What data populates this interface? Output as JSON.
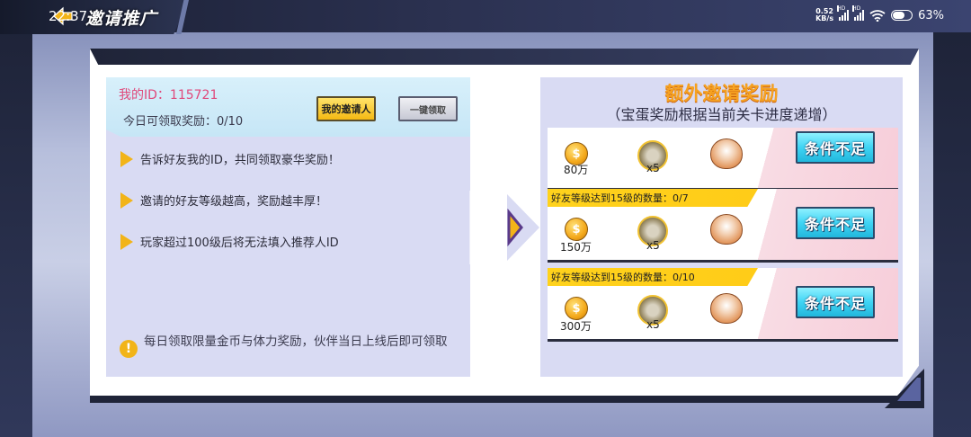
{
  "statusbar": {
    "time": "22:37",
    "speed_top": "0.52",
    "speed_bottom": "KB/s",
    "battery": "63%"
  },
  "header": {
    "title": "邀请推广"
  },
  "left": {
    "my_id_label": "我的ID：115721",
    "daily_label": "今日可领取奖励：0/10",
    "my_inviter_button": "我的邀请人",
    "claim_all_button": "一键领取",
    "tips": [
      "告诉好友我的ID，共同领取豪华奖励！",
      "邀请的好友等级越高，奖励越丰厚！",
      "玩家超过100级后将无法填入推荐人ID"
    ],
    "note": "每日领取限量金币与体力奖励，伙伴当日上线后即可领取"
  },
  "right": {
    "title": "额外邀请奖励",
    "subtitle": "（宝蛋奖励根据当前关卡进度递增）",
    "rows": [
      {
        "condition": "",
        "coin": "80万",
        "hero_count": "x5",
        "button": "条件不足"
      },
      {
        "condition": "好友等级达到15级的数量：0/7",
        "coin": "150万",
        "hero_count": "x5",
        "button": "条件不足"
      },
      {
        "condition": "好友等级达到15级的数量：0/10",
        "coin": "300万",
        "hero_count": "x5",
        "button": "条件不足"
      }
    ]
  },
  "colors": {
    "accent_yellow": "#f2b418",
    "id_pink": "#e0487a",
    "title_orange": "#f6a221",
    "button_cyan": "#3fd4f4"
  },
  "icons": [
    "back-logo-icon",
    "wifi-icon",
    "battery-icon",
    "arrow-right-icon",
    "gold-coin-icon",
    "hero-fragment-icon",
    "treasure-egg-icon",
    "exclamation-icon"
  ]
}
